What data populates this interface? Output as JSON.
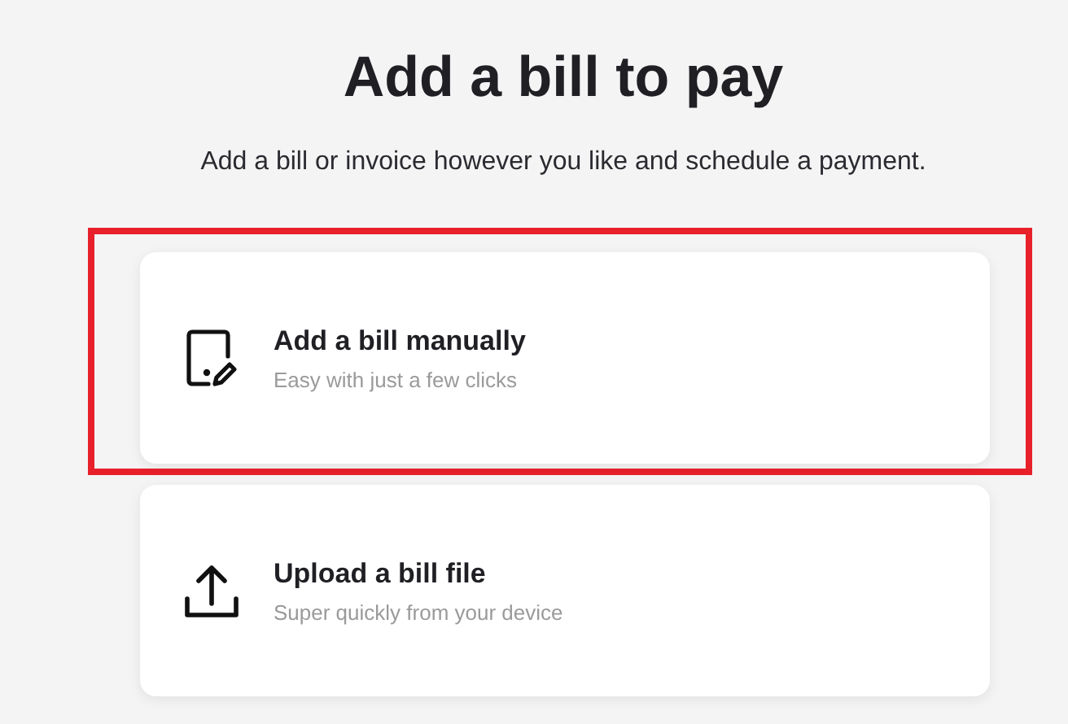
{
  "heading": "Add a bill to pay",
  "subheading": "Add a bill or invoice however you like and schedule a payment.",
  "options": [
    {
      "kind": "manual",
      "title": "Add a bill manually",
      "description": "Easy with just a few clicks",
      "highlighted": true
    },
    {
      "kind": "upload",
      "title": "Upload a bill file",
      "description": "Super quickly from your device",
      "highlighted": false
    }
  ]
}
